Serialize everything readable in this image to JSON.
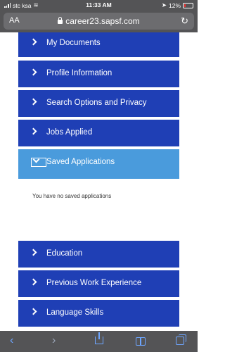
{
  "status_bar": {
    "carrier": "stc ksa",
    "time": "11:33 AM",
    "battery_percent": "12%"
  },
  "browser": {
    "reader_label": "AA",
    "url": "career23.sapsf.com",
    "reload_icon": "reload-icon"
  },
  "menu": {
    "items": [
      {
        "label": "My Documents"
      },
      {
        "label": "Profile Information"
      },
      {
        "label": "Search Options and Privacy"
      },
      {
        "label": "Jobs Applied"
      },
      {
        "label": "Saved Applications"
      },
      {
        "label": "Education"
      },
      {
        "label": "Previous Work Experience"
      },
      {
        "label": "Language Skills"
      }
    ]
  },
  "saved_applications": {
    "empty_message": "You have no saved applications"
  },
  "colors": {
    "menu_blue": "#1f3fb5",
    "active_light_blue": "#4a9bdc",
    "chrome_gray": "#545456",
    "toolbar_blue": "#6ea6ff"
  }
}
